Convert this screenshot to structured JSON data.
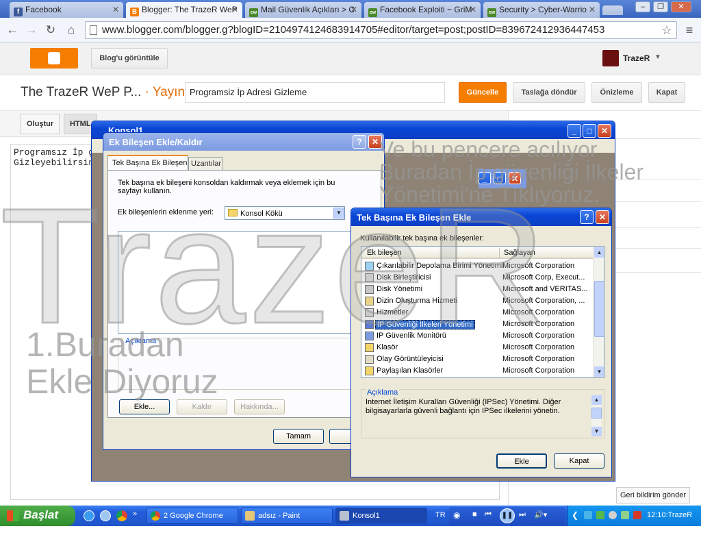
{
  "browser": {
    "tabs": [
      {
        "label": "Facebook",
        "icon": "f"
      },
      {
        "label": "Blogger: The TrazeR WeP",
        "icon": "B"
      },
      {
        "label": "Mail Güvenlik Açıkları > C",
        "icon": "cw"
      },
      {
        "label": "Facebook Exploiti ~ GriM",
        "icon": "cw"
      },
      {
        "label": "Security > Cyber-Warrio",
        "icon": "cw"
      }
    ],
    "url": "www.blogger.com/blogger.g?blogID=2104974124683914705#editor/target=post;postID=839672412936447453"
  },
  "blogger": {
    "view_blog": "Blog'u görüntüle",
    "user": "TrazeR",
    "blog_title": "The TrazeR WeP P...",
    "publish_sep": "· Yayın",
    "post_title": "Programsiz İp Adresi Gizleme",
    "buttons": {
      "update": "Güncelle",
      "revert": "Taslağa döndür",
      "preview": "Önizleme",
      "close": "Kapat"
    },
    "modes": {
      "compose": "Oluştur",
      "html": "HTML"
    },
    "editor_text": [
      "Programsız İp g",
      "Gizleyebilirsin"
    ],
    "feedback": "Geri bildirim gönder"
  },
  "console": {
    "title": "Konsol1"
  },
  "snapin_dialog": {
    "title": "Ek Bileşen Ekle/Kaldır",
    "tabs": [
      "Tek Başına Ek Bileşen",
      "Uzantılar"
    ],
    "info": "Tek başına ek bileşeni konsoldan kaldırmak veya eklemek için bu sayfayı kullanın.",
    "add_location_label": "Ek bileşenlerin eklenme yeri:",
    "add_location_value": "Konsol Kökü",
    "description_label": "Açıklama",
    "buttons": {
      "add": "Ekle...",
      "remove": "Kaldır",
      "about": "Hakkında...",
      "ok": "Tamam",
      "cancel": "İp"
    }
  },
  "add_dialog": {
    "title": "Tek Başına Ek Bileşen Ekle",
    "list_label": "Kullanılabilir tek başına ek bileşenler:",
    "columns": [
      "Ek bileşen",
      "Sağlayan"
    ],
    "rows": [
      {
        "name": "Çıkarılabilir Depolama Birimi Yönetimi",
        "provider": "Microsoft Corporation"
      },
      {
        "name": "Disk Birleştiricisi",
        "provider": "Microsoft Corp, Execut..."
      },
      {
        "name": "Disk Yönetimi",
        "provider": "Microsoft and VERITAS..."
      },
      {
        "name": "Dizin Oluşturma Hizmeti",
        "provider": "Microsoft Corporation, ..."
      },
      {
        "name": "Hizmetler",
        "provider": "Microsoft Corporation"
      },
      {
        "name": "IP Güvenliği İlkeleri Yönetimi",
        "provider": "Microsoft Corporation",
        "selected": true
      },
      {
        "name": "IP Güvenlik Monitörü",
        "provider": "Microsoft Corporation"
      },
      {
        "name": "Klasör",
        "provider": "Microsoft Corporation"
      },
      {
        "name": "Olay Görüntüleyicisi",
        "provider": "Microsoft Corporation"
      },
      {
        "name": "Paylaşılan Klasörler",
        "provider": "Microsoft Corporation"
      }
    ],
    "description_label": "Açıklama",
    "description": "Internet İletişim Kuralları Güvenliği (IPSec) Yönetimi. Diğer bilgisayarlarla güvenli bağlantı için IPSec ilkelerini yönetin.",
    "buttons": {
      "add": "Ekle",
      "close": "Kapat"
    }
  },
  "annotations": {
    "watermark": "TrazeR",
    "step1_line1": "1.Buradan",
    "step1_line2": "Ekle Diyoruz",
    "step2_line1": "Ve bu pencere acılıyor",
    "step2_line2": "Buradan İp güvenliği İlkeler",
    "step2_line3": "Yönetimi'ne Tıklıyoruz."
  },
  "taskbar": {
    "start": "Başlat",
    "tasks": [
      "2 Google Chrome",
      "adsız - Paint",
      "Konsol1"
    ],
    "lang": "TR",
    "clock": "12:10:TrazeR"
  },
  "colors": {
    "accent": "#f57d00",
    "xp_title": "#0a46d4",
    "selection": "#316ac5"
  }
}
